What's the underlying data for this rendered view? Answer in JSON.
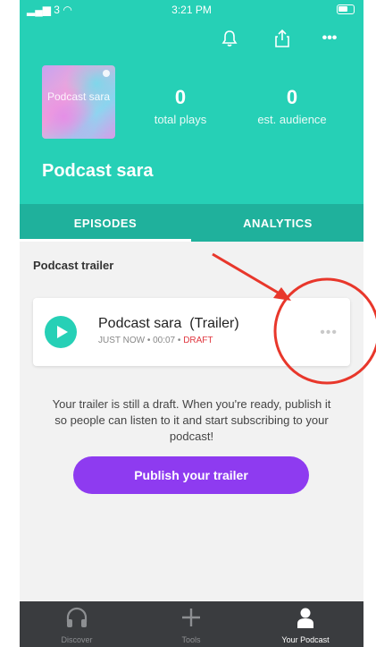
{
  "status_bar": {
    "signal": "3",
    "time": "3:21 PM"
  },
  "header": {
    "icons": [
      "bell-icon",
      "share-icon",
      "more-icon"
    ],
    "artwork_text": "Podcast sara",
    "stats": [
      {
        "value": "0",
        "label": "total plays"
      },
      {
        "value": "0",
        "label": "est. audience"
      }
    ],
    "podcast_title": "Podcast sara"
  },
  "tabs": [
    {
      "label": "EPISODES",
      "active": true
    },
    {
      "label": "ANALYTICS",
      "active": false
    }
  ],
  "section_label": "Podcast trailer",
  "episode": {
    "title": "Podcast sara  (Trailer)",
    "meta": "JUST NOW • 00:07 • ",
    "status": "DRAFT",
    "more_icon": "ellipsis-icon"
  },
  "message": "Your trailer is still a draft. When you're ready, publish it so people can listen to it and start subscribing to your podcast!",
  "publish_button": "Publish your trailer",
  "bottom_nav": [
    {
      "label": "Discover",
      "icon": "headphones-icon",
      "active": false
    },
    {
      "label": "Tools",
      "icon": "plus-icon",
      "active": false
    },
    {
      "label": "Your Podcast",
      "icon": "person-icon",
      "active": true
    }
  ],
  "colors": {
    "header": "#26d0b6",
    "tabs": "#1fb19c",
    "accent_button": "#8e3bf0",
    "draft": "#e0373f",
    "annotation": "#e8372b"
  }
}
